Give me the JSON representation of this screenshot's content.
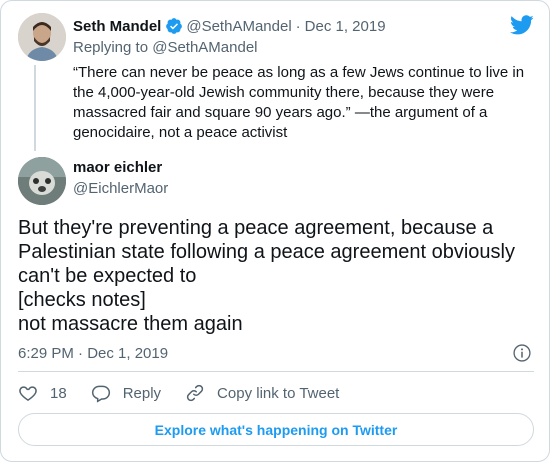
{
  "colors": {
    "accent": "#1d9bf0",
    "text": "#0f1419",
    "muted": "#536471",
    "border": "#cfd9de"
  },
  "parent_tweet": {
    "author_name": "Seth Mandel",
    "author_handle": "@SethAMandel",
    "separator": "·",
    "date": "Dec 1, 2019",
    "verified": true,
    "replying_to": "Replying to @SethAMandel",
    "text": "“There can never be peace as long as a few Jews continue to live in the 4,000-year-old Jewish community there, because they were massacred fair and square 90 years ago.” —the argument of a genocidaire, not a peace activist"
  },
  "tweet": {
    "author_name": "maor eichler",
    "author_handle": "@EichlerMaor",
    "text": "But they're preventing a peace agreement, because a Palestinian state following a peace agreement obviously can't be expected to\n[checks notes]\nnot massacre them again",
    "timestamp": "6:29 PM · Dec 1, 2019"
  },
  "actions": {
    "like_count": "18",
    "reply_label": "Reply",
    "copy_link_label": "Copy link to Tweet"
  },
  "explore_button_label": "Explore what's happening on Twitter",
  "icons": [
    "twitter-bird-icon",
    "verified-badge-icon",
    "info-icon",
    "heart-icon",
    "reply-bubble-icon",
    "link-icon"
  ]
}
